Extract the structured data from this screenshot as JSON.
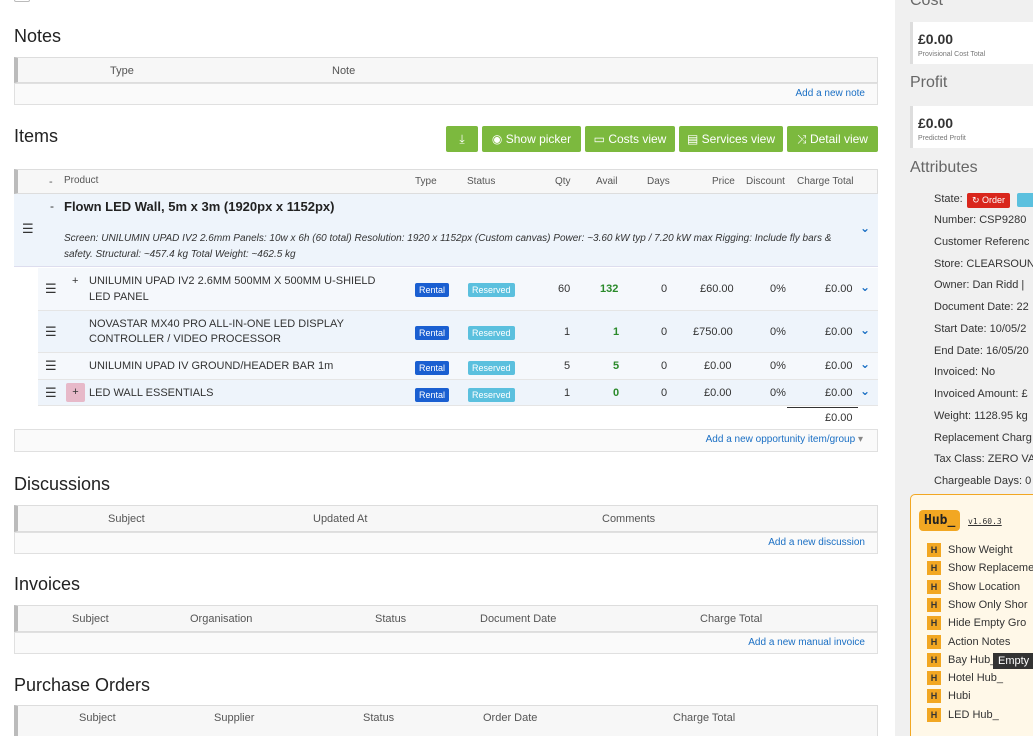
{
  "notes": {
    "title": "Notes",
    "columns": [
      "Type",
      "Note"
    ],
    "add_link": "Add a new note"
  },
  "items": {
    "title": "Items",
    "buttons": {
      "download": "⤓",
      "picker": "Show picker",
      "costs": "Costs view",
      "services": "Services view",
      "detail": "Detail view"
    },
    "columns": {
      "collapse": "-",
      "product": "Product",
      "type": "Type",
      "status": "Status",
      "qty": "Qty",
      "avail": "Avail",
      "days": "Days",
      "price": "Price",
      "discount": "Discount",
      "charge_total": "Charge Total"
    },
    "group": {
      "toggle": "-",
      "name": "Flown LED Wall, 5m x 3m (1920px x 1152px)",
      "description": "Screen: UNILUMIN UPAD IV2 2.6mm Panels: 10w x 6h (60 total) Resolution: 1920 x 1152px (Custom canvas) Power: ~3.60 kW typ / 7.20 kW max Rigging: Include fly bars & safety. Structural: ~457.4 kg Total Weight: ~462.5 kg"
    },
    "rows": [
      {
        "toggle": "+",
        "product_line1": "UNILUMIN UPAD IV2 2.6MM 500MM X 500MM U-SHIELD",
        "product_line2": "LED PANEL",
        "type": "Rental",
        "status": "Reserved",
        "qty": "60",
        "avail": "132",
        "days": "0",
        "price": "£60.00",
        "discount": "0%",
        "total": "£0.00"
      },
      {
        "toggle": "",
        "product_line1": "NOVASTAR MX40 PRO ALL-IN-ONE LED DISPLAY",
        "product_line2": "CONTROLLER / VIDEO PROCESSOR",
        "type": "Rental",
        "status": "Reserved",
        "qty": "1",
        "avail": "1",
        "days": "0",
        "price": "£750.00",
        "discount": "0%",
        "total": "£0.00"
      },
      {
        "toggle": "",
        "product_line1": "UNILUMIN UPAD IV GROUND/HEADER BAR 1m",
        "product_line2": "",
        "type": "Rental",
        "status": "Reserved",
        "qty": "5",
        "avail": "5",
        "days": "0",
        "price": "£0.00",
        "discount": "0%",
        "total": "£0.00"
      },
      {
        "toggle": "+",
        "product_line1": "LED WALL ESSENTIALS",
        "product_line2": "",
        "type": "Rental",
        "status": "Reserved",
        "qty": "1",
        "avail": "0",
        "days": "0",
        "price": "£0.00",
        "discount": "0%",
        "total": "£0.00"
      }
    ],
    "grand_total": "£0.00",
    "add_link": "Add a new opportunity item/group"
  },
  "discussions": {
    "title": "Discussions",
    "columns": [
      "Subject",
      "Updated At",
      "Comments"
    ],
    "add_link": "Add a new discussion"
  },
  "invoices": {
    "title": "Invoices",
    "columns": [
      "Subject",
      "Organisation",
      "Status",
      "Document Date",
      "Charge Total"
    ],
    "add_link": "Add a new manual invoice"
  },
  "purchase_orders": {
    "title": "Purchase Orders",
    "columns": [
      "Subject",
      "Supplier",
      "Status",
      "Order Date",
      "Charge Total"
    ]
  },
  "sidebar": {
    "cost_heading": "Cost",
    "cost_value": "£0.00",
    "cost_caption": "Provisional Cost Total",
    "profit_heading": "Profit",
    "profit_value": "£0.00",
    "profit_caption": "Predicted Profit",
    "attributes_heading": "Attributes",
    "state_label": "State:",
    "state_badge": "Order",
    "attributes": [
      "Number: CSP9280",
      "Customer Referenc",
      "Store: CLEARSOUN",
      "Owner: Dan Ridd |",
      "Document Date: 22",
      "Start Date:  10/05/2",
      "End Date:  16/05/20",
      "Invoiced: No",
      "Invoiced Amount: £",
      "Weight: 1128.95 kg",
      "Replacement Charg",
      "Tax Class: ZERO VA",
      "Chargeable Days: 0"
    ],
    "hub": {
      "logo": "Hub_",
      "version": "v1.60.3",
      "items": [
        "Show Weight",
        "Show Replaceme",
        "Show Location",
        "Show Only Shor",
        "Hide Empty Gro",
        "Action Notes",
        "Bay Hub_",
        "Hotel Hub_",
        "Hubi",
        "LED Hub_"
      ],
      "tooltip": "Empty"
    }
  }
}
